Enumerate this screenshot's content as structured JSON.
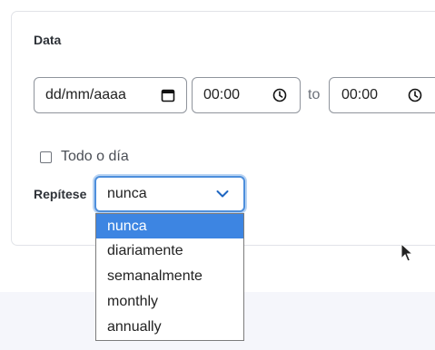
{
  "form": {
    "date_section_label": "Data",
    "date_placeholder": "dd/mm/aaaa",
    "start_time": "00:00",
    "to_label": "to",
    "end_time": "00:00",
    "allday_label": "Todo o día",
    "allday_checked": false,
    "repeat_label": "Repítese",
    "repeat_selected": "nunca",
    "repeat_options": [
      "nunca",
      "diariamente",
      "semanalmente",
      "monthly",
      "annually"
    ]
  },
  "colors": {
    "accent": "#3d85e2",
    "focus_ring": "#4e8fdc",
    "page_bg": "#f5f6fb"
  },
  "icons": {
    "date_field": "calendar-icon",
    "time_fields": "clock-icon",
    "select": "chevron-down-icon",
    "pointer": "mouse-cursor-icon"
  }
}
